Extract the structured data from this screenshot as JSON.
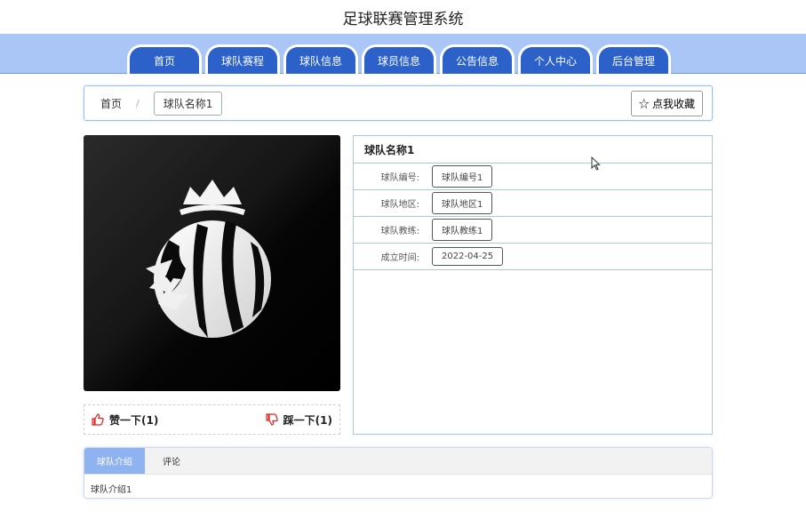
{
  "site_title": "足球联赛管理系统",
  "nav": {
    "tabs": [
      "首页",
      "球队赛程",
      "球队信息",
      "球员信息",
      "公告信息",
      "个人中心",
      "后台管理"
    ]
  },
  "breadcrumb": {
    "home": "首页",
    "separator": "/",
    "current": "球队名称1",
    "favorite_label": "☆ 点我收藏"
  },
  "team": {
    "title": "球队名称1",
    "fields": [
      {
        "label": "球队编号:",
        "value": "球队编号1"
      },
      {
        "label": "球队地区:",
        "value": "球队地区1"
      },
      {
        "label": "球队教练:",
        "value": "球队教练1"
      },
      {
        "label": "成立时间:",
        "value": "2022-04-25"
      }
    ]
  },
  "votes": {
    "like_label": "赞一下(1)",
    "dislike_label": "踩一下(1)"
  },
  "detail": {
    "tabs": [
      "球队介绍",
      "评论"
    ],
    "active_tab": "球队介绍",
    "content": "球队介绍1"
  },
  "colors": {
    "nav_bg": "#a9c6f6",
    "tab_bg": "#2b61c9",
    "active_detail_tab": "#8fb3f0",
    "vote_icon": "#e02020"
  }
}
